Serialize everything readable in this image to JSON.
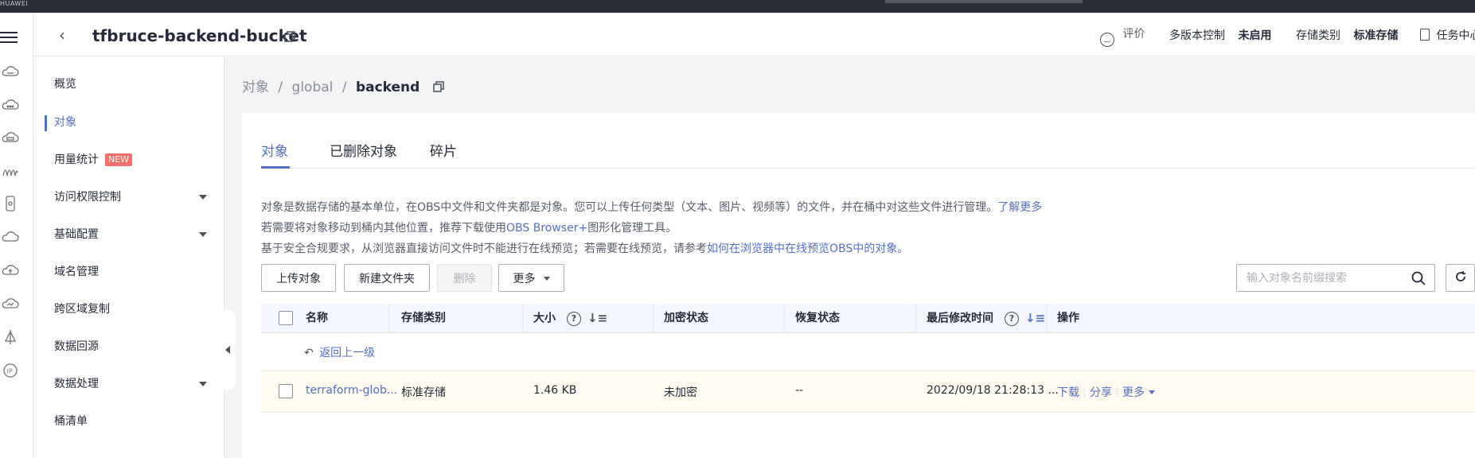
{
  "topbar": {
    "logo": "HUAWEI"
  },
  "header": {
    "bucket_name": "tfbruce-backend-bucket",
    "feedback_label": "评价",
    "versioning_label": "多版本控制",
    "versioning_value": "未启用",
    "storage_class_label": "存储类别",
    "storage_class_value": "标准存储",
    "task_center_label": "任务中心"
  },
  "sidebar": {
    "items": [
      {
        "label": "概览"
      },
      {
        "label": "对象"
      },
      {
        "label": "用量统计",
        "badge": "NEW"
      },
      {
        "label": "访问权限控制"
      },
      {
        "label": "基础配置"
      },
      {
        "label": "域名管理"
      },
      {
        "label": "跨区域复制"
      },
      {
        "label": "数据回源"
      },
      {
        "label": "数据处理"
      },
      {
        "label": "桶清单"
      }
    ]
  },
  "breadcrumb": {
    "root": "对象",
    "sep1": "/",
    "mid": "global",
    "sep2": "/",
    "current": "backend"
  },
  "tabs": [
    {
      "label": "对象"
    },
    {
      "label": "已删除对象"
    },
    {
      "label": "碎片"
    }
  ],
  "info": {
    "line1_text": "对象是数据存储的基本单位，在OBS中文件和文件夹都是对象。您可以上传任何类型（文本、图片、视频等）的文件，并在桶中对这些文件进行管理。",
    "line1_link": "了解更多",
    "line2_text_a": "若需要将对象移动到桶内其他位置，推荐下载使用",
    "line2_link": "OBS Browser+",
    "line2_text_b": "图形化管理工具。",
    "line3_text": "基于安全合规要求，从浏览器直接访问文件时不能进行在线预览；若需要在线预览，请参考",
    "line3_link": "如何在浏览器中在线预览OBS中的对象。"
  },
  "toolbar": {
    "upload_label": "上传对象",
    "new_folder_label": "新建文件夹",
    "delete_label": "删除",
    "more_label": "更多",
    "search_placeholder": "输入对象名前缀搜索"
  },
  "table": {
    "columns": {
      "name": "名称",
      "storage_class": "存储类别",
      "size": "大小",
      "encryption": "加密状态",
      "restore": "恢复状态",
      "modified": "最后修改时间",
      "actions": "操作"
    },
    "back_link": "返回上一级",
    "rows": [
      {
        "name": "terraform-glob...",
        "storage_class": "标准存储",
        "size": "1.46 KB",
        "encryption": "未加密",
        "restore": "--",
        "modified": "2022/09/18 21:28:13 ...",
        "action_download": "下载",
        "action_share": "分享",
        "action_more": "更多"
      }
    ]
  }
}
